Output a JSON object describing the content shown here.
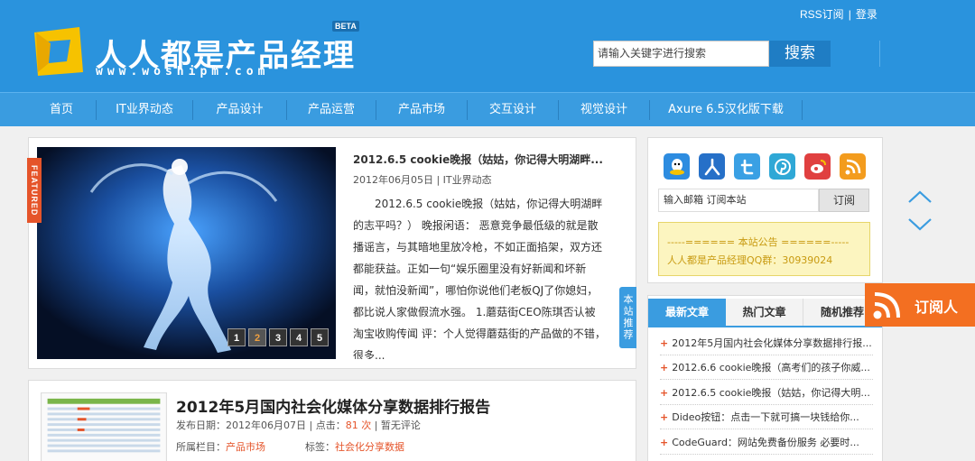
{
  "header": {
    "site_title": "人人都是产品经理",
    "site_sub": "www.woshipm.com",
    "beta": "BETA",
    "rss_link": "RSS订阅",
    "login_link": "登录",
    "search_placeholder": "请输入关键字进行搜索",
    "search_button": "搜索"
  },
  "nav": {
    "items": [
      "首页",
      "IT业界动态",
      "产品设计",
      "产品运营",
      "产品市场",
      "交互设计",
      "视觉设计",
      "Axure 6.5汉化版下载"
    ]
  },
  "featured": {
    "ribbon": "FEATURED",
    "title": "2012.6.5 cookie晚报（姑姑，你记得大明湖畔...",
    "meta": "2012年06月05日 | IT业界动态",
    "body": "2012.6.5 cookie晚报（姑姑，你记得大明湖畔的志平吗？） 晚报闲语： 恶意竞争最低级的就是散播谣言，与其暗地里放冷枪，不如正面掐架，双方还都能获益。正如一句“娱乐圈里没有好新闻和坏新闻，就怕没新闻”，哪怕你说他们老板QJ了你媳妇，都比说人家做假流水强。 1.蘑菇街CEO陈琪否认被淘宝收购传闻 评：个人觉得蘑菇街的产品做的不错，很多...",
    "slider": [
      "1",
      "2",
      "3",
      "4",
      "5"
    ],
    "recommend_tab": "本站推荐"
  },
  "article": {
    "title": "2012年5月国内社会化媒体分享数据排行报告",
    "date_label": "发布日期：",
    "date": "2012年06月07日",
    "clicks_label": "点击：",
    "clicks": "81 次",
    "comments": "暂无评论",
    "column_label": "所属栏目：",
    "column": "产品市场",
    "tags_label": "标签：",
    "tags": "社会化分享数据"
  },
  "sidebar": {
    "subscribe_placeholder": "输入邮箱 订阅本站",
    "subscribe_button": "订阅",
    "notice_title": "-----====== 本站公告 ======-----",
    "notice_body": "人人都是产品经理QQ群：30939024",
    "tabs": [
      "最新文章",
      "热门文章",
      "随机推荐"
    ],
    "list": [
      "2012年5月国内社会化媒体分享数据排行报...",
      "2012.6.6 cookie晚报（高考们的孩子你威...",
      "2012.6.5 cookie晚报（姑姑，你记得大明...",
      "Dideo按钮：点击一下就可搞一块钱给你...",
      "CodeGuard：网站免费备份服务 必要时..."
    ]
  },
  "float": {
    "rss_text": "订阅人"
  },
  "colors": {
    "header_blue": "#2a93dd",
    "nav_blue": "#3a9ce0",
    "accent_orange": "#e5542a",
    "rss_orange": "#f36f21"
  }
}
